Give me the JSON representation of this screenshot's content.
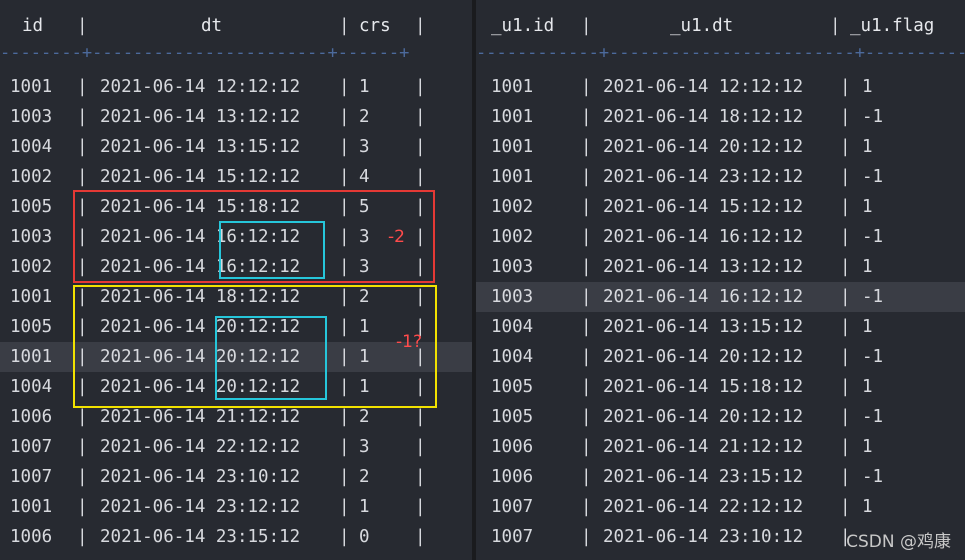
{
  "left": {
    "headers": {
      "id": "id",
      "dt": "dt",
      "crs": "crs"
    },
    "sep_line": "--------+-----------------------+------+",
    "rows": [
      {
        "id": "1001",
        "dt": "2021-06-14 12:12:12",
        "crs": "1"
      },
      {
        "id": "1003",
        "dt": "2021-06-14 13:12:12",
        "crs": "2"
      },
      {
        "id": "1004",
        "dt": "2021-06-14 13:15:12",
        "crs": "3"
      },
      {
        "id": "1002",
        "dt": "2021-06-14 15:12:12",
        "crs": "4"
      },
      {
        "id": "1005",
        "dt": "2021-06-14 15:18:12",
        "crs": "5"
      },
      {
        "id": "1003",
        "dt": "2021-06-14 16:12:12",
        "crs": "3"
      },
      {
        "id": "1002",
        "dt": "2021-06-14 16:12:12",
        "crs": "3"
      },
      {
        "id": "1001",
        "dt": "2021-06-14 18:12:12",
        "crs": "2"
      },
      {
        "id": "1005",
        "dt": "2021-06-14 20:12:12",
        "crs": "1"
      },
      {
        "id": "1001",
        "dt": "2021-06-14 20:12:12",
        "crs": "1"
      },
      {
        "id": "1004",
        "dt": "2021-06-14 20:12:12",
        "crs": "1"
      },
      {
        "id": "1006",
        "dt": "2021-06-14 21:12:12",
        "crs": "2"
      },
      {
        "id": "1007",
        "dt": "2021-06-14 22:12:12",
        "crs": "3"
      },
      {
        "id": "1007",
        "dt": "2021-06-14 23:10:12",
        "crs": "2"
      },
      {
        "id": "1001",
        "dt": "2021-06-14 23:12:12",
        "crs": "1"
      },
      {
        "id": "1006",
        "dt": "2021-06-14 23:15:12",
        "crs": "0"
      }
    ],
    "annotations": {
      "red_note": "-2",
      "yellow_note": "-1?"
    }
  },
  "right": {
    "headers": {
      "id": "_u1.id",
      "dt": "_u1.dt",
      "flag": "_u1.flag"
    },
    "sep_line": "------------+------------------------+-----------",
    "rows": [
      {
        "id": "1001",
        "dt": "2021-06-14 12:12:12",
        "flag": "1"
      },
      {
        "id": "1001",
        "dt": "2021-06-14 18:12:12",
        "flag": "-1"
      },
      {
        "id": "1001",
        "dt": "2021-06-14 20:12:12",
        "flag": "1"
      },
      {
        "id": "1001",
        "dt": "2021-06-14 23:12:12",
        "flag": "-1"
      },
      {
        "id": "1002",
        "dt": "2021-06-14 15:12:12",
        "flag": "1"
      },
      {
        "id": "1002",
        "dt": "2021-06-14 16:12:12",
        "flag": "-1"
      },
      {
        "id": "1003",
        "dt": "2021-06-14 13:12:12",
        "flag": "1"
      },
      {
        "id": "1003",
        "dt": "2021-06-14 16:12:12",
        "flag": "-1"
      },
      {
        "id": "1004",
        "dt": "2021-06-14 13:15:12",
        "flag": "1"
      },
      {
        "id": "1004",
        "dt": "2021-06-14 20:12:12",
        "flag": "-1"
      },
      {
        "id": "1005",
        "dt": "2021-06-14 15:18:12",
        "flag": "1"
      },
      {
        "id": "1005",
        "dt": "2021-06-14 20:12:12",
        "flag": "-1"
      },
      {
        "id": "1006",
        "dt": "2021-06-14 21:12:12",
        "flag": "1"
      },
      {
        "id": "1006",
        "dt": "2021-06-14 23:15:12",
        "flag": "-1"
      },
      {
        "id": "1007",
        "dt": "2021-06-14 22:12:12",
        "flag": "1"
      },
      {
        "id": "1007",
        "dt": "2021-06-14 23:10:12",
        "flag": ""
      }
    ]
  },
  "watermark": "CSDN @鸡康"
}
